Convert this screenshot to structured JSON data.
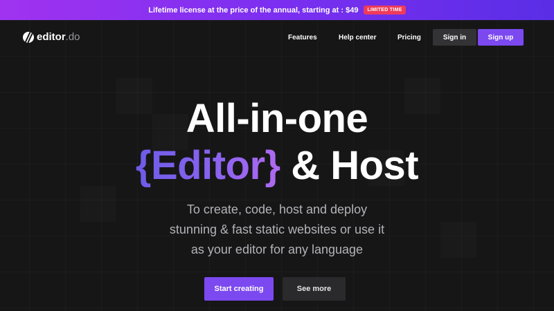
{
  "promo": {
    "text": "Lifetime license at the price of the annual, starting at : $49",
    "badge": "LIMITED TIME"
  },
  "brand": {
    "name": "editor",
    "tld": ".do",
    "logo_icon": "editor-logo-icon"
  },
  "nav": {
    "features": "Features",
    "help_center": "Help center",
    "pricing": "Pricing",
    "sign_in": "Sign in",
    "sign_up": "Sign up"
  },
  "hero": {
    "line1": "All-in-one",
    "accent": "{Editor}",
    "line2_rest": " & Host",
    "subtitle_lines": [
      "To create, code, host and deploy",
      "stunning & fast static websites or use it",
      "as your editor for any language"
    ],
    "cta_primary": "Start creating",
    "cta_secondary": "See more"
  },
  "colors": {
    "background": "#161617",
    "accent": "#7c49f0",
    "promo_gradient_start": "#a033f0",
    "promo_gradient_end": "#5a2ee6",
    "badge": "#ee3b5b"
  }
}
